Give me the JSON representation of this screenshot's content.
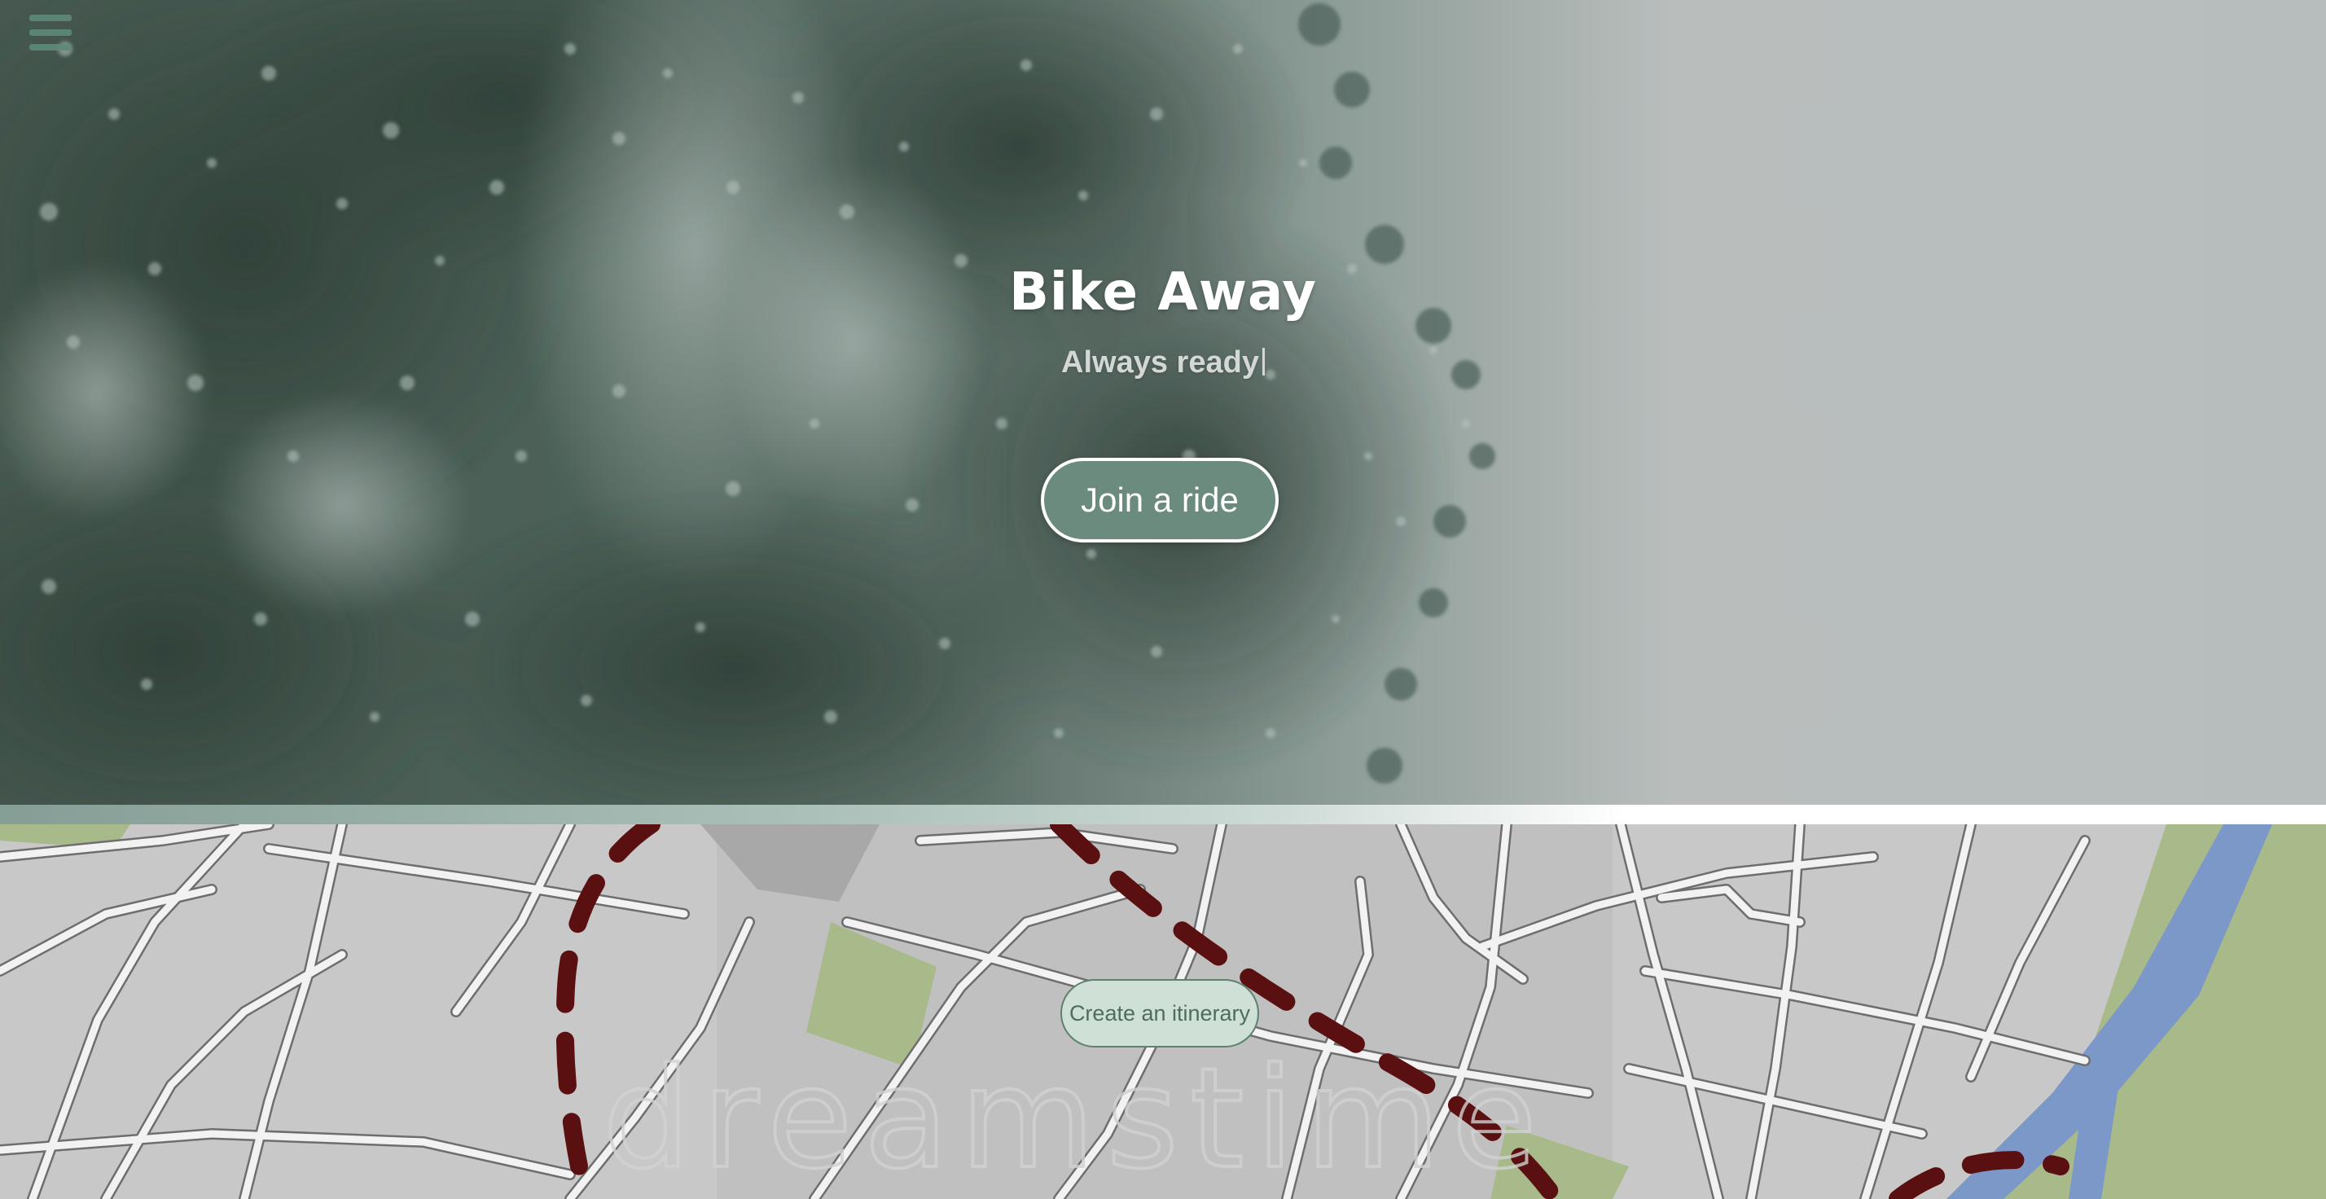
{
  "nav": {
    "menu_icon": "hamburger-menu-icon"
  },
  "hero": {
    "title": "Bike Away",
    "subtitle": "Always ready",
    "cta_label": "Join a ride",
    "image": "tree-foliage-photo"
  },
  "map_section": {
    "button_label": "Create an itinerary",
    "watermark": "dreamstime",
    "image": "street-map-with-dashed-route"
  },
  "colors": {
    "accent": "#6a8b7d",
    "accent_light": "#cfe0d6",
    "route": "#5a0f10",
    "river": "#7b98c9",
    "park": "#a8b98a"
  }
}
